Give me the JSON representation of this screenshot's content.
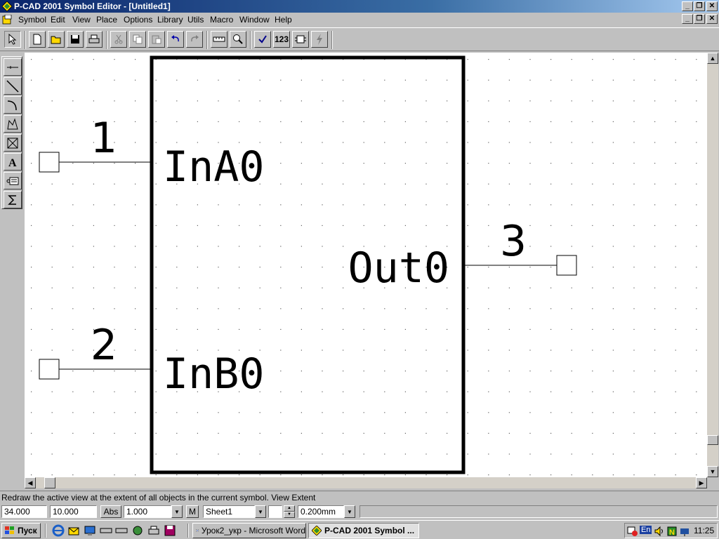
{
  "window": {
    "title": "P-CAD 2001 Symbol Editor - [Untitled1]",
    "caption_buttons": [
      "_",
      "❐",
      "✕"
    ]
  },
  "menu": {
    "items": [
      "Symbol",
      "Edit",
      "View",
      "Place",
      "Options",
      "Library",
      "Utils",
      "Macro",
      "Window",
      "Help"
    ]
  },
  "toolbar": {
    "count_button": "123"
  },
  "symbol": {
    "pins": [
      {
        "number": "1",
        "name": "InA0"
      },
      {
        "number": "2",
        "name": "InB0"
      },
      {
        "number": "3",
        "name": "Out0"
      }
    ]
  },
  "statusline": {
    "text": "Redraw the active view at the extent of all objects in the current symbol. View Extent"
  },
  "fields": {
    "x": "34.000",
    "y": "10.000",
    "abs": "Abs",
    "grid": "1.000",
    "m": "M",
    "sheet": "Sheet1",
    "layer": "",
    "width": "0.200mm"
  },
  "taskbar": {
    "start": "Пуск",
    "tasks": [
      {
        "label": "Урок2_укр - Microsoft Word"
      },
      {
        "label": "P-CAD 2001 Symbol ..."
      }
    ],
    "lang": "En",
    "clock": "11:25"
  },
  "colors": {
    "titlebar_start": "#0a246a",
    "face": "#c0c0c0",
    "canvas": "#ffffff",
    "grid_dot": "#606060"
  }
}
